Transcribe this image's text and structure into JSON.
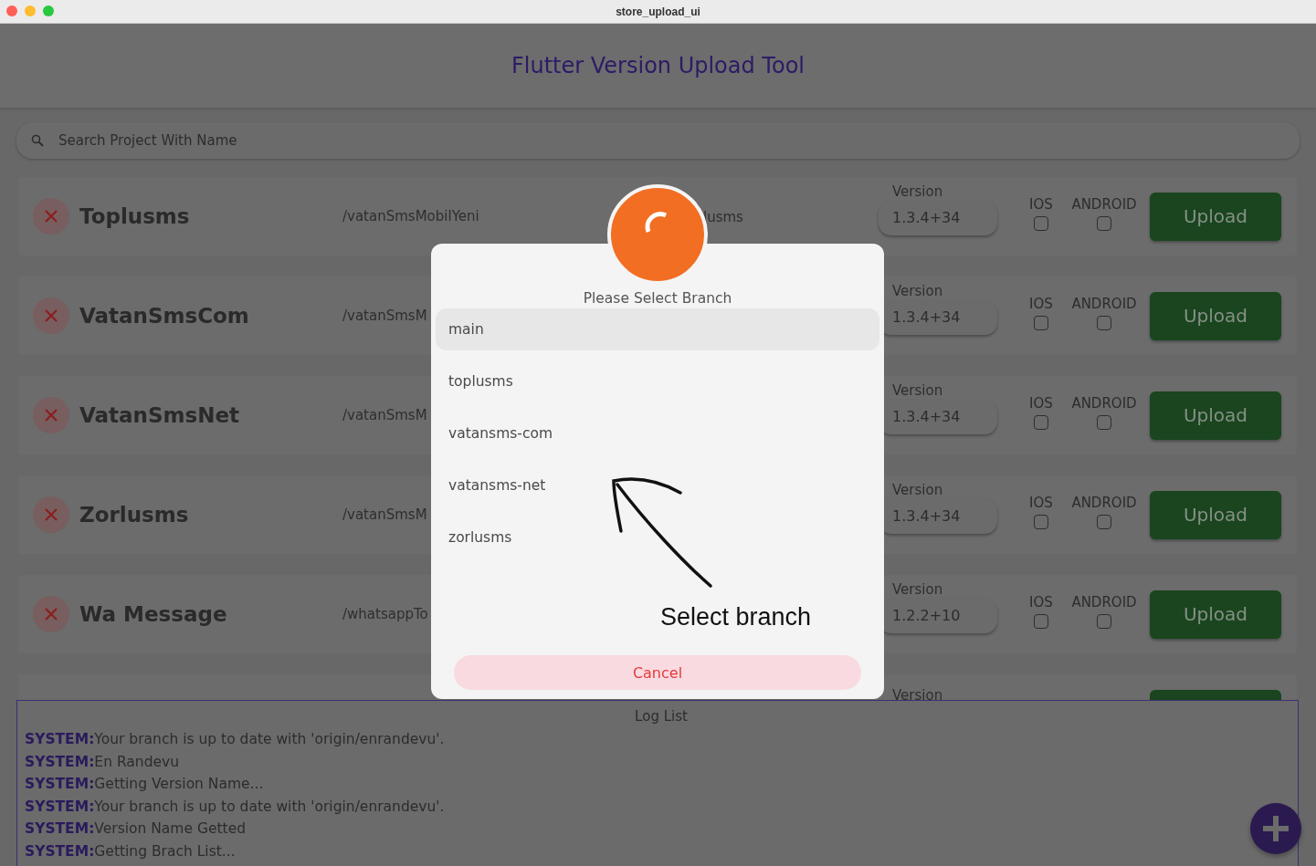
{
  "window": {
    "title": "store_upload_ui"
  },
  "header": {
    "title": "Flutter Version Upload Tool"
  },
  "search": {
    "placeholder": "Search Project With Name"
  },
  "projects": [
    {
      "kind": "full",
      "name": "Toplusms",
      "path": "/vatanSmsMobilYeni",
      "branch": "lusms",
      "version_label": "Version",
      "version": "1.3.4+34",
      "ios_label": "IOS",
      "ios_checked": false,
      "android_label": "ANDROID",
      "android_checked": false,
      "button": "Upload"
    },
    {
      "kind": "full",
      "name": "VatanSmsCom",
      "path": "/vatanSmsM",
      "version_label": "Version",
      "version": "1.3.4+34",
      "ios_label": "IOS",
      "ios_checked": false,
      "android_label": "ANDROID",
      "android_checked": false,
      "button": "Upload"
    },
    {
      "kind": "full",
      "name": "VatanSmsNet",
      "path": "/vatanSmsM",
      "version_label": "Version",
      "version": "1.3.4+34",
      "ios_label": "IOS",
      "ios_checked": false,
      "android_label": "ANDROID",
      "android_checked": false,
      "button": "Upload"
    },
    {
      "kind": "full",
      "name": "Zorlusms",
      "path": "/vatanSmsM",
      "version_label": "Version",
      "version": "1.3.4+34",
      "ios_label": "IOS",
      "ios_checked": false,
      "android_label": "ANDROID",
      "android_checked": false,
      "button": "Upload"
    },
    {
      "kind": "full",
      "name": "Wa Message",
      "path": "/whatsappTo",
      "version_label": "Version",
      "version": "1.2.2+10",
      "ios_label": "IOS",
      "ios_checked": false,
      "android_label": "ANDROID",
      "android_checked": false,
      "button": "Upload"
    },
    {
      "kind": "partial",
      "version_label": "Version"
    }
  ],
  "log": {
    "title": "Log List",
    "lines": [
      "**SYSTEM:**Your branch is up to date with 'origin/enrandevu'.",
      "**SYSTEM:**En Randevu",
      "**SYSTEM:**Getting Version Name...",
      "**SYSTEM:**Your branch is up to date with 'origin/enrandevu'.",
      "**SYSTEM:**Version Name Getted",
      "**SYSTEM:**Getting Brach List..."
    ]
  },
  "dialog": {
    "title": "Please Select Branch",
    "branches": [
      {
        "label": "main",
        "selected": true
      },
      {
        "label": "toplusms",
        "selected": false
      },
      {
        "label": "vatansms-com",
        "selected": false
      },
      {
        "label": "vatansms-net",
        "selected": false
      },
      {
        "label": "zorlusms",
        "selected": false
      }
    ],
    "annotation": "Select branch",
    "cancel": "Cancel"
  }
}
